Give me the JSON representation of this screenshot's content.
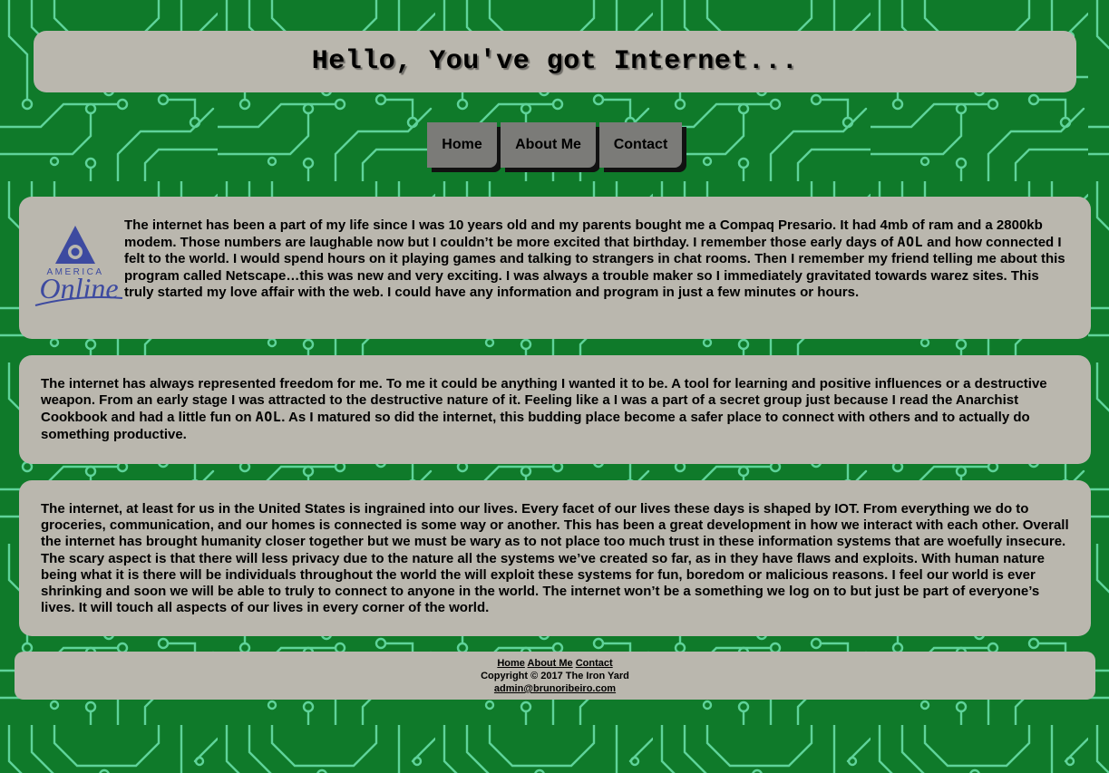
{
  "header": {
    "title": "Hello, You've got Internet..."
  },
  "nav": {
    "items": [
      {
        "label": "Home"
      },
      {
        "label": "About Me"
      },
      {
        "label": "Contact"
      }
    ]
  },
  "sections": {
    "intro": {
      "logo": {
        "line1": "AMERICA",
        "line2": "Online"
      },
      "text_a": "The internet has been a part of my life since I was 10 years old and my parents bought me a Compaq Presario. It had 4mb of ram and a 2800kb modem. Those numbers are laughable now but I couldn’t be more excited that birthday. I remember those early days of ",
      "aol": "AOL",
      "text_b": " and how connected I felt to the world. I would spend hours on it playing games and talking to strangers in chat rooms. Then I remember my friend telling me about this program called Netscape…this was new and very exciting. I was always a trouble maker so I immediately gravitated towards warez sites. This truly started my love affair with the web. I could have any information and program in just a few minutes or hours."
    },
    "freedom": {
      "text_a": "The internet has always represented freedom for me. To me it could be anything I wanted it to be. A tool for learning and positive influences or a destructive weapon. From an early stage I was attracted to the destructive nature of it. Feeling like a I was a part of a secret group just because I read the Anarchist Cookbook and had a little fun on ",
      "aol": "AOL",
      "text_b": ". As I matured so did the internet, this budding place become a safer place to connect with others and to actually do something productive."
    },
    "future": {
      "text": "The internet, at least for us in the United States is ingrained into our lives. Every facet of our lives these days is shaped by IOT. From everything we do to groceries, communication, and our homes is connected is some way or another. This has been a great development in how we interact with each other. Overall the internet has brought humanity closer together but we must be wary as to not place too much trust in these information systems that are woefully insecure. The scary aspect is that there will less privacy due to the nature all the systems we’ve created so far, as in they have flaws and exploits. With human nature being what it is there will be individuals throughout the world the will exploit these systems for fun, boredom or malicious reasons. I feel our world is ever shrinking and soon we will be able to truly to connect to anyone in the world. The internet won’t be a something we log on to but just be part of everyone’s lives. It will touch all aspects of our lives in every corner of the world."
    }
  },
  "footer": {
    "links": [
      {
        "label": "Home"
      },
      {
        "label": "About Me"
      },
      {
        "label": "Contact"
      }
    ],
    "copyright": "Copyright © 2017 The Iron Yard",
    "email": "admin@brunoribeiro.com"
  },
  "colors": {
    "background": "#0f7a2a",
    "circuit": "#5fd39a",
    "panel": "#bab7ae",
    "nav_button": "#7b7b78",
    "logo_blue": "#3d4aa0"
  },
  "icons": {
    "logo": "aol-logo-icon"
  }
}
